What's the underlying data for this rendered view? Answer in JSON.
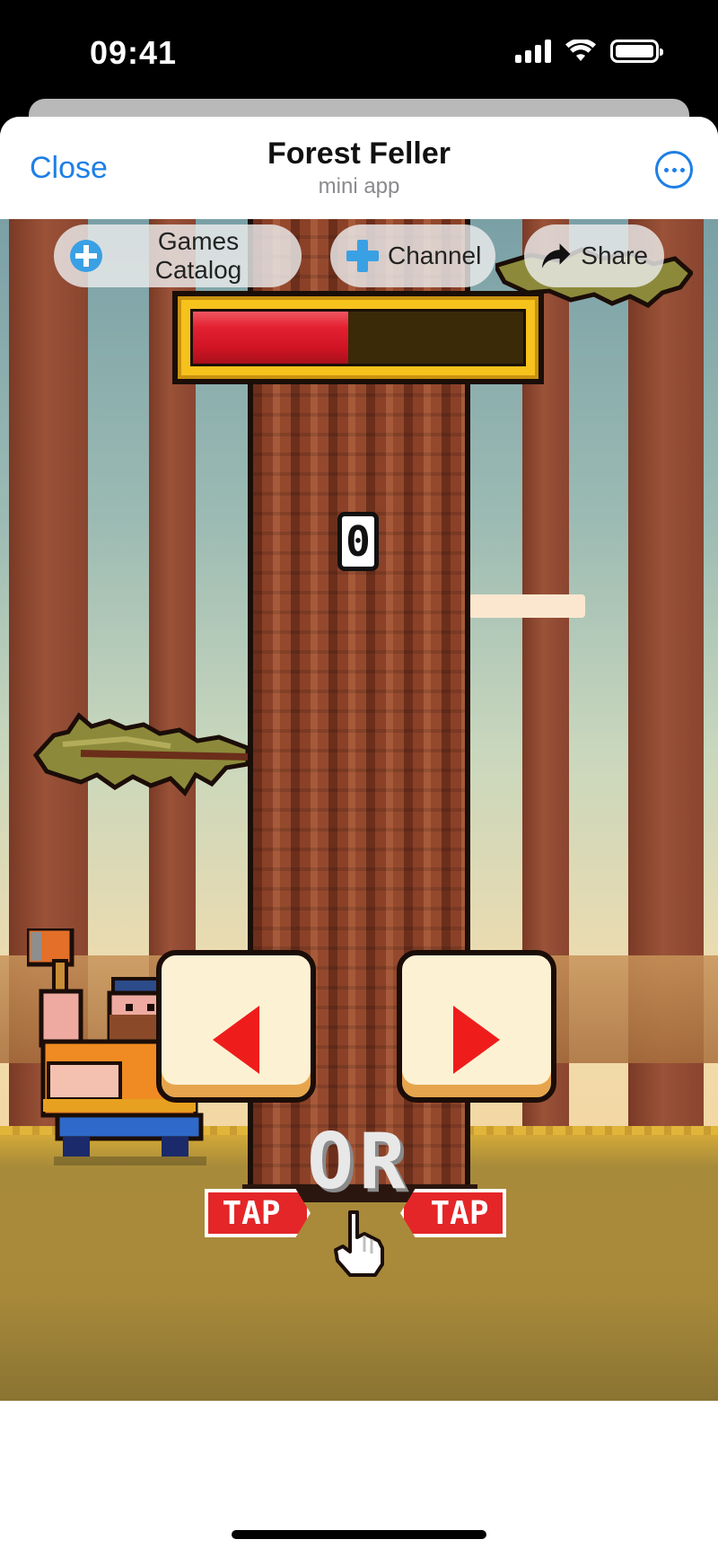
{
  "status_bar": {
    "time": "09:41",
    "icons": [
      "signal-icon",
      "wifi-icon",
      "battery-icon"
    ]
  },
  "header": {
    "close_label": "Close",
    "title": "Forest Feller",
    "subtitle": "mini app",
    "more_icon": "ellipsis-circle-icon"
  },
  "top_buttons": [
    {
      "label": "Games Catalog",
      "icon": "gamepad-icon"
    },
    {
      "label": "Channel",
      "icon": "gamepad-icon"
    },
    {
      "label": "Share",
      "icon": "share-arrow-icon"
    }
  ],
  "game": {
    "energy_fraction": 0.47,
    "score": "0",
    "or_label": "OR",
    "tap_label": "TAP",
    "arrow_left_icon": "arrow-left-icon",
    "arrow_right_icon": "arrow-right-icon",
    "hand_icon": "pointing-hand-icon"
  },
  "colors": {
    "accent_blue": "#1e7fe6",
    "energy_red": "#e32131",
    "frame_gold": "#f6c21c",
    "tap_red": "#e42628"
  }
}
